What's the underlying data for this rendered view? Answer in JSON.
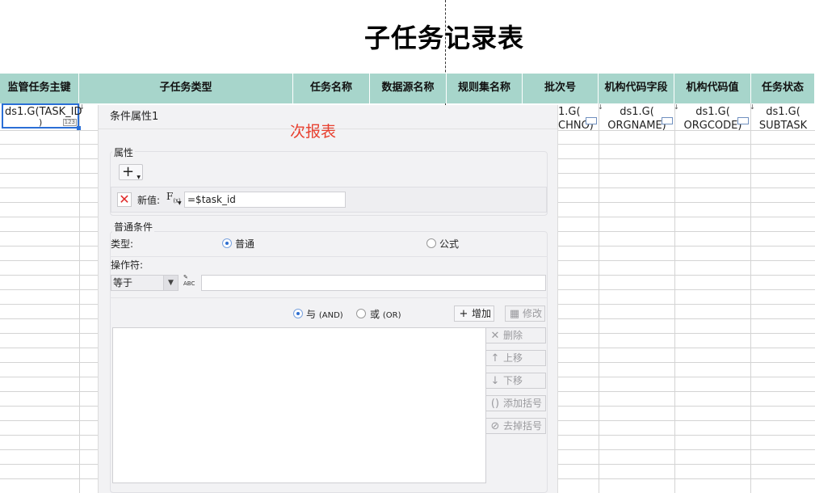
{
  "sheet": {
    "title": "子任务记录表",
    "columns": [
      "监管任务主键",
      "子任务类型",
      "任务名称",
      "数据源名称",
      "规则集名称",
      "批次号",
      "机构代码字段",
      "机构代码值",
      "任务状态"
    ],
    "selected_cell": {
      "line1": "ds1.G(TASK_ID",
      "line2": ")",
      "badge": "123"
    },
    "row1_cells": [
      {
        "line1": "1.G(",
        "line2": "CHNO)"
      },
      {
        "line1": "ds1.G(",
        "line2": "ORGNAME)"
      },
      {
        "line1": "ds1.G(",
        "line2": "ORGCODE)"
      },
      {
        "line1": "ds1.G(",
        "line2": "SUBTASK"
      }
    ]
  },
  "dialog": {
    "title": "条件属性1",
    "sub_report_label": "次报表",
    "attributes_group": "属性",
    "add_symbol": "+",
    "delete_symbol": "✕",
    "new_value_label": "新值:",
    "fx_label": "F",
    "fx_sub": "(x)",
    "new_value": "=$task_id",
    "normal_condition_group": "普通条件",
    "type_label": "类型:",
    "type_options": [
      {
        "label": "普通",
        "selected": true
      },
      {
        "label": "公式",
        "selected": false
      }
    ],
    "operator_label": "操作符:",
    "operator_value": "等于",
    "abc_icon_text": "ABC",
    "logic_options": [
      {
        "label": "与",
        "tag": "(AND)",
        "selected": true
      },
      {
        "label": "或",
        "tag": "(OR)",
        "selected": false
      }
    ],
    "buttons": {
      "add": "增加",
      "modify": "修改",
      "delete": "删除",
      "move_up": "上移",
      "move_down": "下移",
      "add_bracket": "添加括号",
      "remove_bracket": "去掉括号"
    }
  }
}
